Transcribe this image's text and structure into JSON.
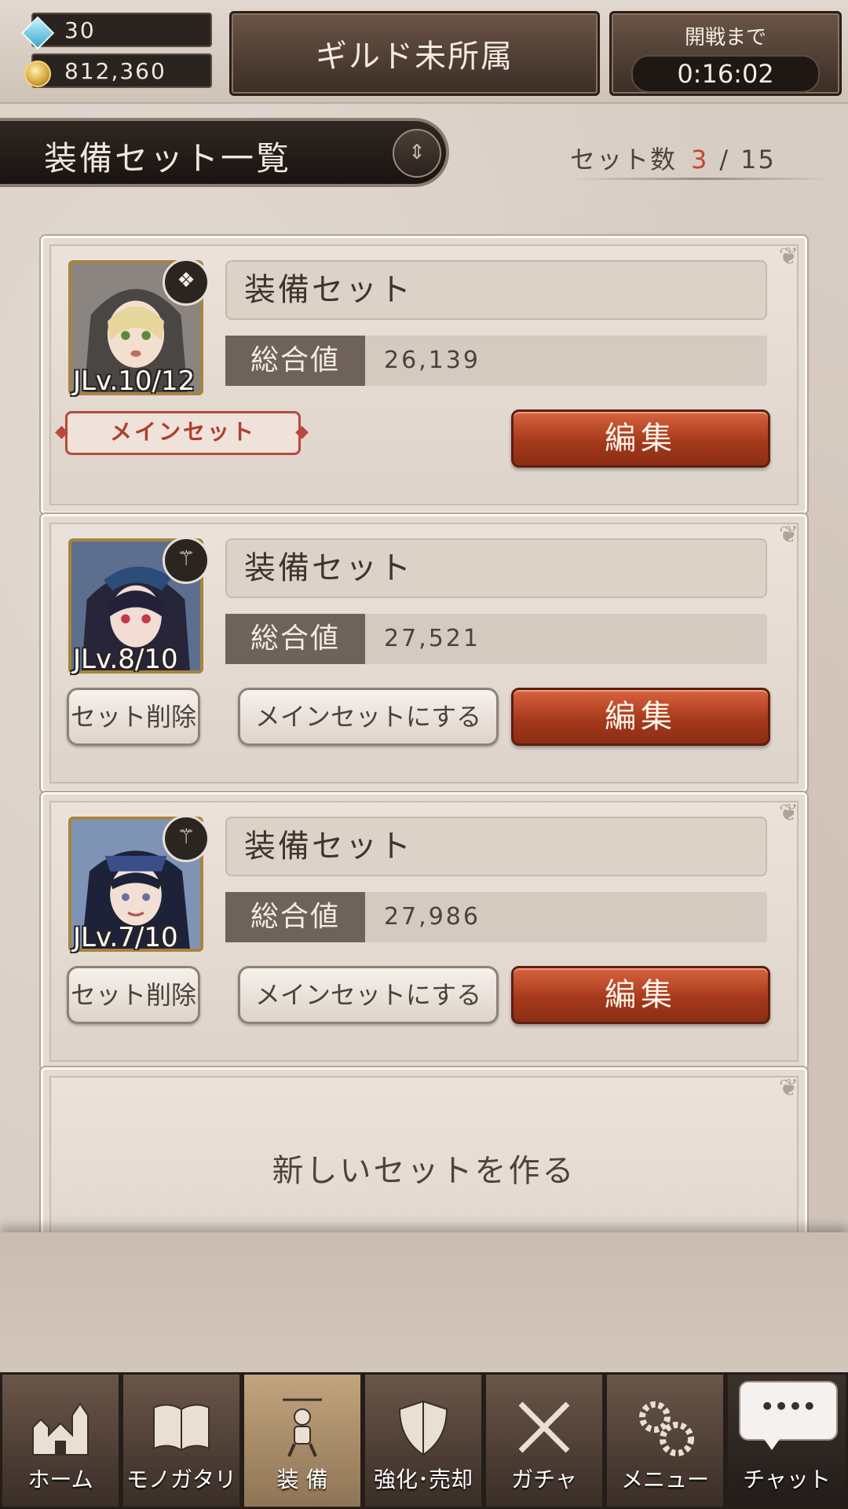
{
  "header": {
    "gems": "30",
    "gold": "812,360",
    "guild_status": "ギルド未所属",
    "timer_label": "開戦まで",
    "timer_value": "0:16:02"
  },
  "section": {
    "title": "装備セット一覧",
    "count_label": "セット数",
    "count_current": "3",
    "count_separator": "/",
    "count_max": "15"
  },
  "sets": [
    {
      "name": "装備セット",
      "stat_label": "総合値",
      "stat_value": "26,139",
      "jlv": "JLv.10/12",
      "weapon_icon": "book-icon",
      "main_label": "メインセット",
      "edit_label": "編集"
    },
    {
      "name": "装備セット",
      "stat_label": "総合値",
      "stat_value": "27,521",
      "jlv": "JLv.8/10",
      "weapon_icon": "staff-icon",
      "delete_label": "セット削除",
      "make_main_label": "メインセットにする",
      "edit_label": "編集"
    },
    {
      "name": "装備セット",
      "stat_label": "総合値",
      "stat_value": "27,986",
      "jlv": "JLv.7/10",
      "weapon_icon": "staff-icon",
      "delete_label": "セット削除",
      "make_main_label": "メインセットにする",
      "edit_label": "編集"
    }
  ],
  "new_set_label": "新しいセットを作る",
  "nav": [
    {
      "label": "ホーム",
      "icon": "castle-icon"
    },
    {
      "label": "モノガタリ",
      "icon": "book-icon"
    },
    {
      "label": "装 備",
      "icon": "puppet-icon"
    },
    {
      "label": "強化･売却",
      "icon": "shield-icon"
    },
    {
      "label": "ガチャ",
      "icon": "swords-icon"
    },
    {
      "label": "メニュー",
      "icon": "gear-icon"
    }
  ],
  "chat": {
    "label": "チャット",
    "bubble": "••••"
  },
  "colors": {
    "accent": "#c0472a",
    "edit_button": "#a53a1c",
    "frame_gold": "#a7843f"
  }
}
